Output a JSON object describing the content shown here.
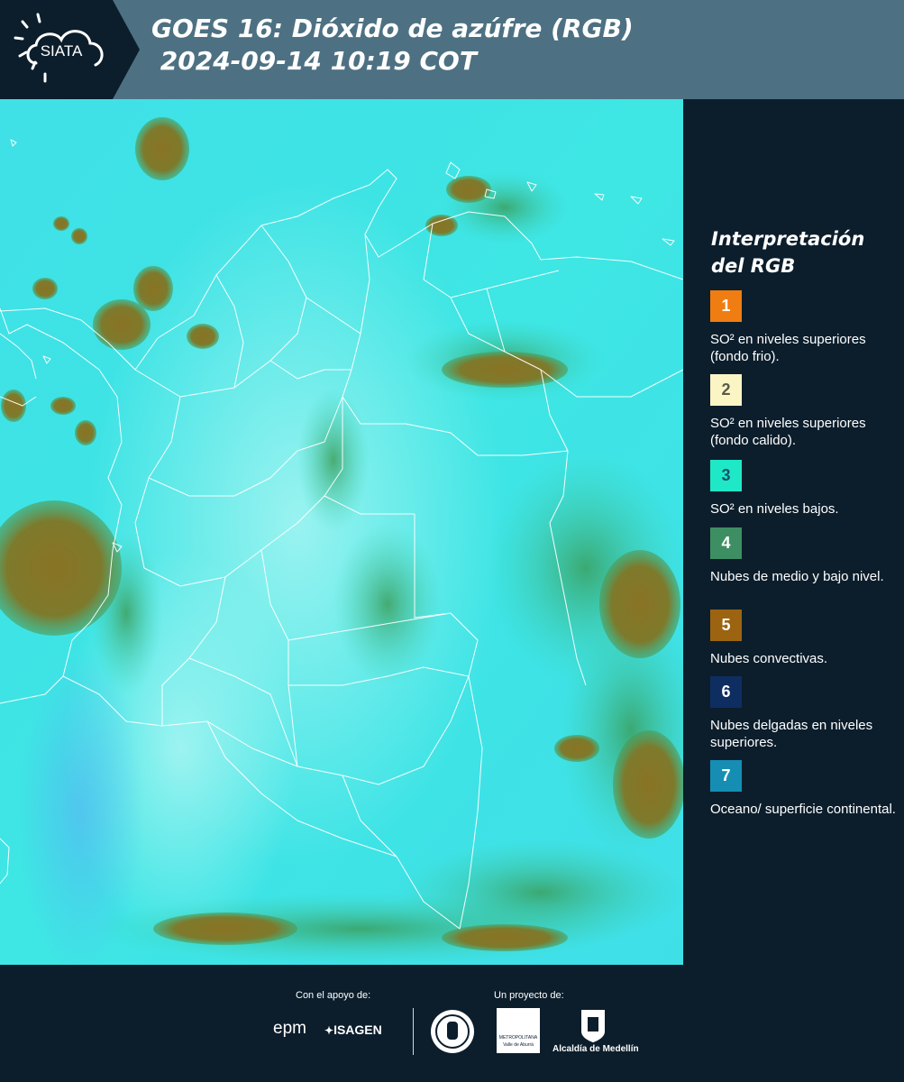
{
  "header": {
    "logo_text": "SIATA",
    "title": "GOES 16: Dióxido de azúfre (RGB)\n 2024-09-14 10:19 COT"
  },
  "map": {
    "background_color": "#3fe2e5",
    "cloud_color": "#8a7a2a",
    "border_color": "#ffffff"
  },
  "legend": {
    "title": "Interpretación del RGB",
    "items": [
      {
        "number": "1",
        "color": "#f07d12",
        "text": "SO² en niveles superiores (fondo frio)."
      },
      {
        "number": "2",
        "color": "#fbf5c5",
        "text": "SO² en niveles superiores (fondo calido)."
      },
      {
        "number": "3",
        "color": "#1fe8c7",
        "text": "SO² en niveles bajos."
      },
      {
        "number": "4",
        "color": "#3d8f63",
        "text": "Nubes de medio y bajo nivel."
      },
      {
        "number": "5",
        "color": "#9c6410",
        "text": "Nubes convectivas."
      },
      {
        "number": "6",
        "color": "#0e2e62",
        "text": "Nubes delgadas en niveles superiores."
      },
      {
        "number": "7",
        "color": "#168eb4",
        "text": "Oceano/ superficie continental."
      }
    ]
  },
  "footer": {
    "support_label": "Con el apoyo de:",
    "project_label": "Un proyecto de:",
    "epm": "epm",
    "isagen": "ISAGEN",
    "area_metro": "METROPOLITANA",
    "area_sub": "Valle de Aburrá",
    "alcaldia": "Alcaldía de Medellín"
  }
}
